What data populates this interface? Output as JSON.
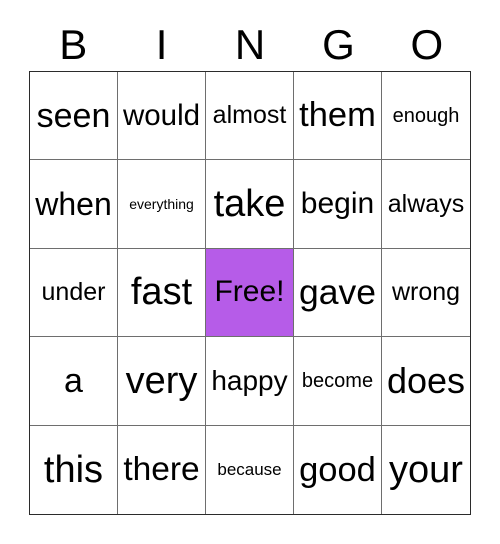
{
  "card": {
    "title_letters": [
      "B",
      "I",
      "N",
      "G",
      "O"
    ],
    "free_space_color": "#b65ce8",
    "border_color": "#2b2b2b",
    "grid_line_color": "#6e6e6e",
    "text_color": "#000000",
    "rows": [
      [
        {
          "label": "seen",
          "size": "lg",
          "free": false
        },
        {
          "label": "would",
          "size": "md",
          "free": false
        },
        {
          "label": "almost",
          "size": "sm",
          "free": false
        },
        {
          "label": "them",
          "size": "xl",
          "free": false
        },
        {
          "label": "enough",
          "size": "xs",
          "free": false
        }
      ],
      [
        {
          "label": "when",
          "size": "lg",
          "free": false
        },
        {
          "label": "everything",
          "size": "tiny",
          "free": false
        },
        {
          "label": "take",
          "size": "xl",
          "free": false
        },
        {
          "label": "begin",
          "size": "md",
          "free": false
        },
        {
          "label": "always",
          "size": "sm",
          "free": false
        }
      ],
      [
        {
          "label": "under",
          "size": "sm",
          "free": false
        },
        {
          "label": "fast",
          "size": "xl",
          "free": false
        },
        {
          "label": "Free!",
          "size": "md",
          "free": true
        },
        {
          "label": "gave",
          "size": "xl",
          "free": false
        },
        {
          "label": "wrong",
          "size": "sm",
          "free": false
        }
      ],
      [
        {
          "label": "a",
          "size": "lg",
          "free": false
        },
        {
          "label": "very",
          "size": "xl",
          "free": false
        },
        {
          "label": "happy",
          "size": "md",
          "free": false
        },
        {
          "label": "become",
          "size": "xs",
          "free": false
        },
        {
          "label": "does",
          "size": "xl",
          "free": false
        }
      ],
      [
        {
          "label": "this",
          "size": "xl",
          "free": false
        },
        {
          "label": "there",
          "size": "lg",
          "free": false
        },
        {
          "label": "because",
          "size": "xxs",
          "free": false
        },
        {
          "label": "good",
          "size": "xl",
          "free": false
        },
        {
          "label": "your",
          "size": "xl",
          "free": false
        }
      ]
    ]
  }
}
